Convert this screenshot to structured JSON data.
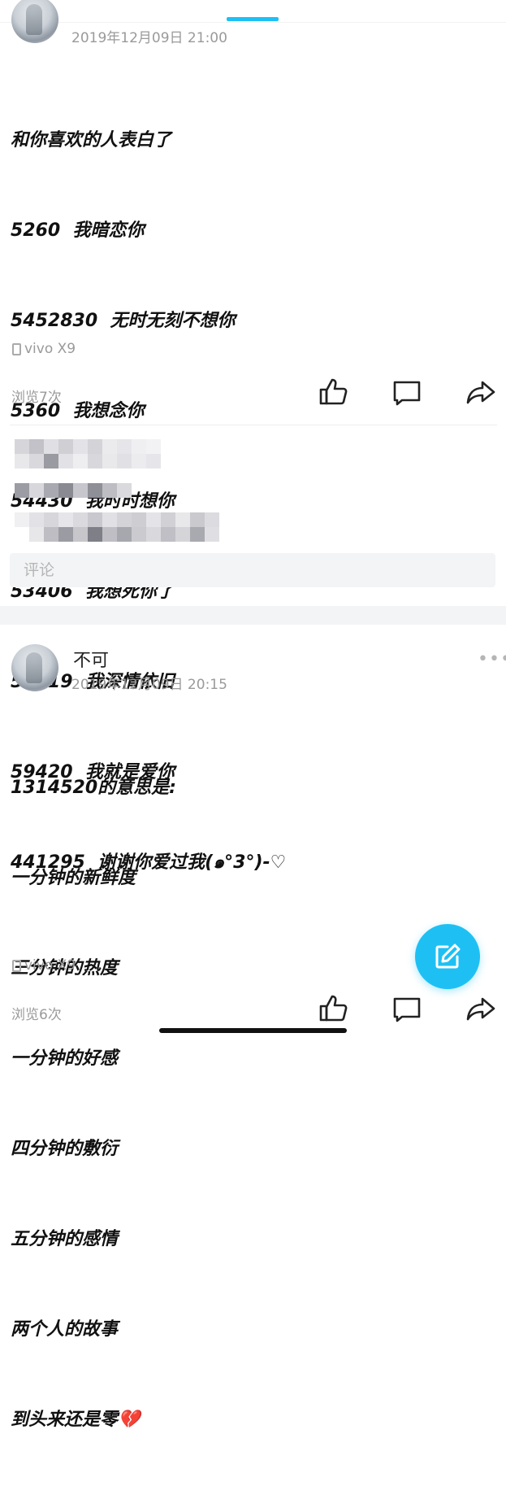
{
  "posts": [
    {
      "username": "",
      "timestamp": "2019年12月09日 21:00",
      "lines": [
        "和你喜欢的人表白了",
        "5260  我暗恋你",
        "5452830  无时无刻不想你",
        "5360  我想念你",
        "54430  我时时想你",
        "53406  我想死你了",
        "53719  我深情依旧",
        "59420  我就是爱你",
        "441295  谢谢你爱过我(๑°3°)-♡"
      ],
      "device": "vivo X9",
      "views": "浏览7次",
      "comment_placeholder": "评论"
    },
    {
      "username": "不可",
      "timestamp": "2019年12月09日 20:15",
      "more": "•••",
      "lines": [
        "1314520的意思是:",
        "一分钟的新鲜度",
        "三分钟的热度",
        "一分钟的好感",
        "四分钟的敷衍",
        "五分钟的感情",
        "两个人的故事",
        "到头来还是零💔"
      ],
      "device": "vivo X9",
      "views": "浏览6次"
    }
  ],
  "icons": {
    "like": "thumbs-up-icon",
    "comment": "comment-bubble-icon",
    "share": "share-arrow-icon",
    "compose": "compose-edit-icon",
    "phone": "phone-icon"
  },
  "colors": {
    "accent": "#1ec0f4",
    "meta_text": "#9a9a9a",
    "background_gray": "#f3f4f6"
  }
}
